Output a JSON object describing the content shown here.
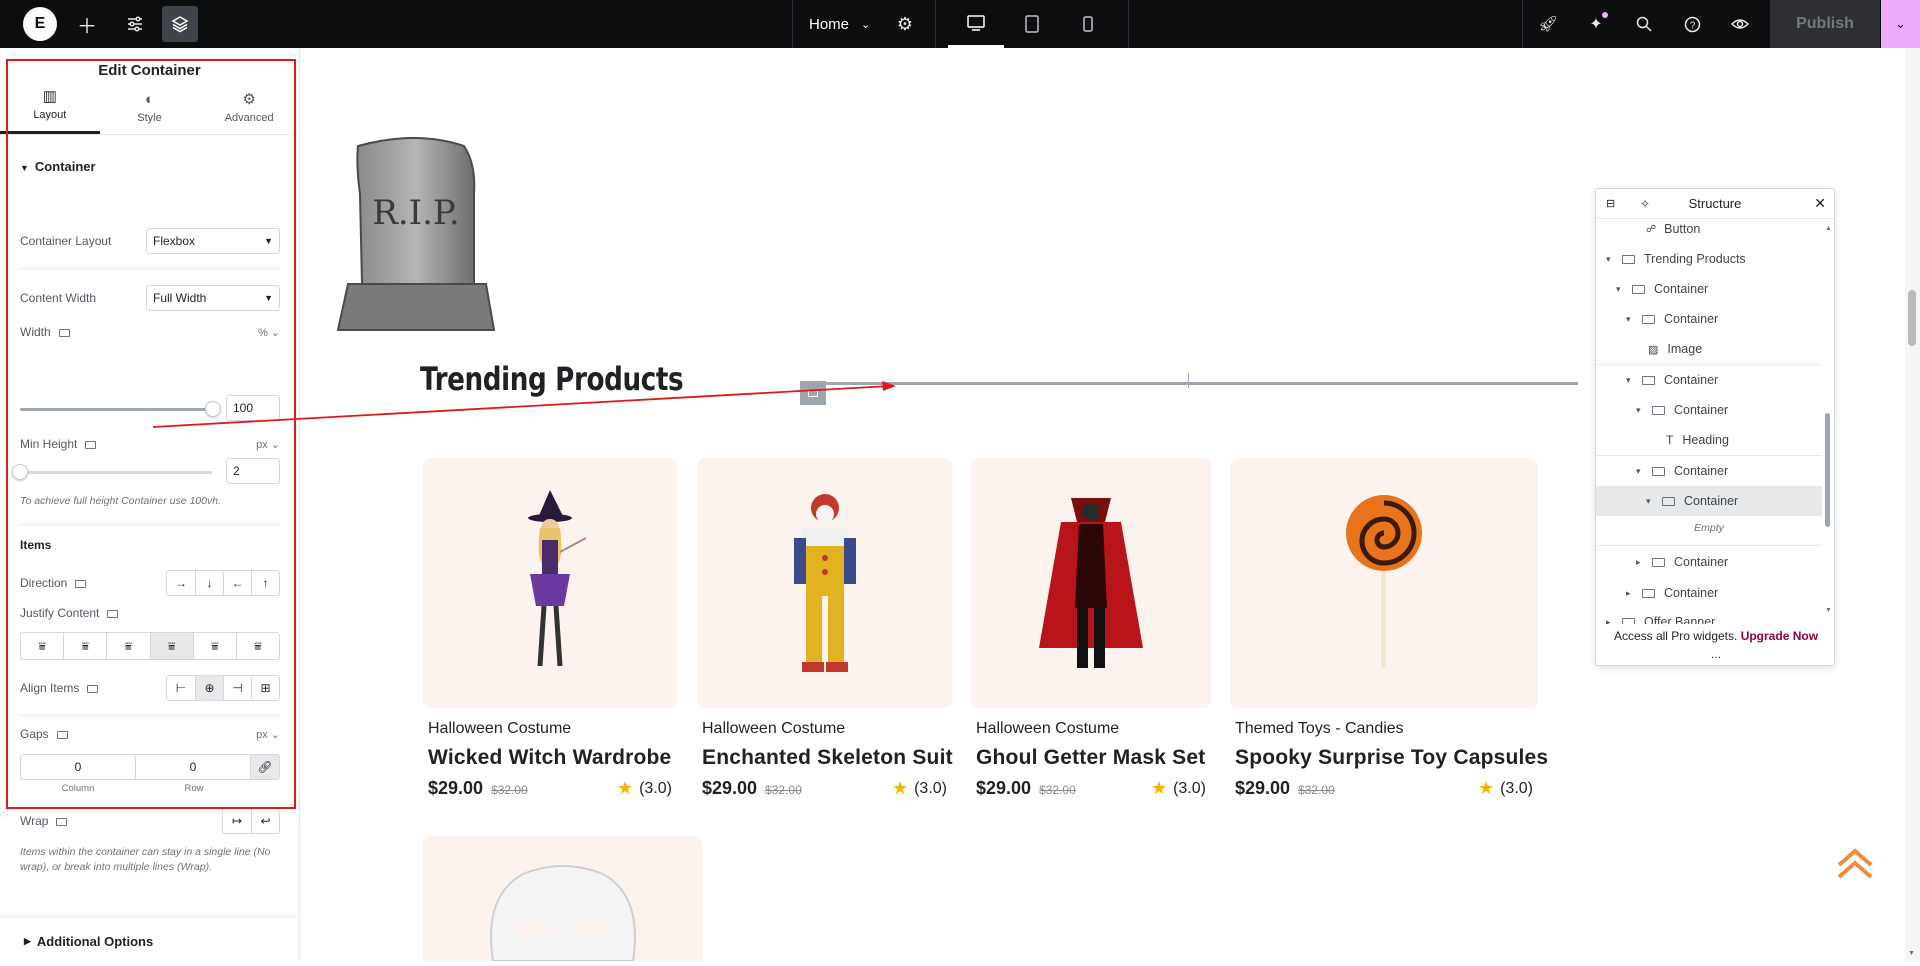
{
  "topbar": {
    "logo": "E",
    "page_name": "Home",
    "publish_label": "Publish"
  },
  "panel": {
    "title": "Edit Container",
    "tabs": [
      {
        "label": "Layout",
        "icon": "layout-icon",
        "active": true
      },
      {
        "label": "Style",
        "icon": "style-icon",
        "active": false
      },
      {
        "label": "Advanced",
        "icon": "gear-icon",
        "active": false
      }
    ],
    "section_container": "Container",
    "container_layout": {
      "label": "Container Layout",
      "value": "Flexbox"
    },
    "content_width": {
      "label": "Content Width",
      "value": "Full Width"
    },
    "width": {
      "label": "Width",
      "unit": "%",
      "value": "100"
    },
    "min_height": {
      "label": "Min Height",
      "unit": "px",
      "value": "2"
    },
    "min_height_hint": "To achieve full height Container use 100vh.",
    "items_heading": "Items",
    "direction_label": "Direction",
    "justify_label": "Justify Content",
    "align_label": "Align Items",
    "gaps": {
      "label": "Gaps",
      "unit": "px",
      "column_value": "0",
      "row_value": "0",
      "column_label": "Column",
      "row_label": "Row"
    },
    "wrap_label": "Wrap",
    "wrap_hint": "Items within the container can stay in a single line (No wrap), or break into multiple lines (Wrap).",
    "additional_options": "Additional Options"
  },
  "canvas": {
    "tombstone_text": "R.I.P.",
    "section_title": "Trending Products",
    "products": [
      {
        "category": "Halloween Costume",
        "name": "Wicked Witch Wardrobe",
        "price": "$29.00",
        "old_price": "$32.00",
        "rating": "(3.0)",
        "icon": "witch-figure"
      },
      {
        "category": "Halloween Costume",
        "name": "Enchanted Skeleton Suit",
        "price": "$29.00",
        "old_price": "$32.00",
        "rating": "(3.0)",
        "icon": "clown-figure"
      },
      {
        "category": "Halloween Costume",
        "name": "Ghoul Getter Mask Set",
        "price": "$29.00",
        "old_price": "$32.00",
        "rating": "(3.0)",
        "icon": "vampire-figure"
      },
      {
        "category": "Themed Toys - Candies",
        "name": "Spooky Surprise Toy Capsules",
        "price": "$29.00",
        "old_price": "$32.00",
        "rating": "(3.0)",
        "icon": "lollipop"
      }
    ]
  },
  "structure": {
    "title": "Structure",
    "items": [
      {
        "label": "Button",
        "depth": 4,
        "arrow": ""
      },
      {
        "label": "Trending Products",
        "depth": 0,
        "arrow": "▾"
      },
      {
        "label": "Container",
        "depth": 1,
        "arrow": "▾"
      },
      {
        "label": "Container",
        "depth": 2,
        "arrow": "▾"
      },
      {
        "label": "Image",
        "depth": 3,
        "arrow": ""
      },
      {
        "label": "Container",
        "depth": 2,
        "arrow": "▾"
      },
      {
        "label": "Container",
        "depth": 3,
        "arrow": "▾"
      },
      {
        "label": "Heading",
        "depth": 4,
        "arrow": ""
      },
      {
        "label": "Container",
        "depth": 3,
        "arrow": "▾"
      },
      {
        "label": "Container",
        "depth": 4,
        "arrow": "▾",
        "selected": true
      },
      {
        "label": "Container",
        "depth": 3,
        "arrow": "▸"
      },
      {
        "label": "Container",
        "depth": 2,
        "arrow": "▸"
      },
      {
        "label": "Offer Banner",
        "depth": 0,
        "arrow": "▸"
      }
    ],
    "empty_label": "Empty",
    "footer_text": "Access all Pro widgets.",
    "footer_link": "Upgrade Now",
    "more": "..."
  },
  "colors": {
    "accent": "#93003f",
    "annotation": "#e0181b",
    "star": "#f5b301",
    "publish_menu": "#f0abfc"
  }
}
